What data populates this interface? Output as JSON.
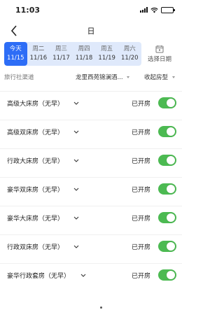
{
  "status_bar": {
    "time": "11:03",
    "icons": [
      "signal-icon",
      "wifi-icon",
      "battery-icon"
    ]
  },
  "nav": {
    "title": "日",
    "back_icon": "back-chevron-icon"
  },
  "dates": [
    {
      "weekday": "今天",
      "date": "11/15",
      "active": true
    },
    {
      "weekday": "周二",
      "date": "11/16",
      "active": false
    },
    {
      "weekday": "周三",
      "date": "11/17",
      "active": false
    },
    {
      "weekday": "周四",
      "date": "11/18",
      "active": false
    },
    {
      "weekday": "周五",
      "date": "11/19",
      "active": false
    },
    {
      "weekday": "周六",
      "date": "11/20",
      "active": false
    }
  ],
  "pick_date": {
    "label": "选择日期",
    "icon": "calendar-icon"
  },
  "filters": {
    "channel": "旅行社渠道",
    "hotel": "龙里西苑锦澜酒...",
    "collapse": "收起房型"
  },
  "rooms": [
    {
      "name": "高级大床房（无早）",
      "status": "已开房",
      "on": true
    },
    {
      "name": "高级双床房（无早）",
      "status": "已开房",
      "on": true
    },
    {
      "name": "行政大床房（无早）",
      "status": "已开房",
      "on": true
    },
    {
      "name": "豪华双床房（无早）",
      "status": "已开房",
      "on": true
    },
    {
      "name": "豪华大床房（无早）",
      "status": "已开房",
      "on": true
    },
    {
      "name": "行政双床房（无早）",
      "status": "已开房",
      "on": true
    },
    {
      "name": "豪华行政套房（无早）",
      "status": "已开房",
      "on": true
    }
  ],
  "colors": {
    "accent": "#2d6df6",
    "toggle_on": "#4cba52",
    "date_strip_bg": "#dfe9fb"
  }
}
